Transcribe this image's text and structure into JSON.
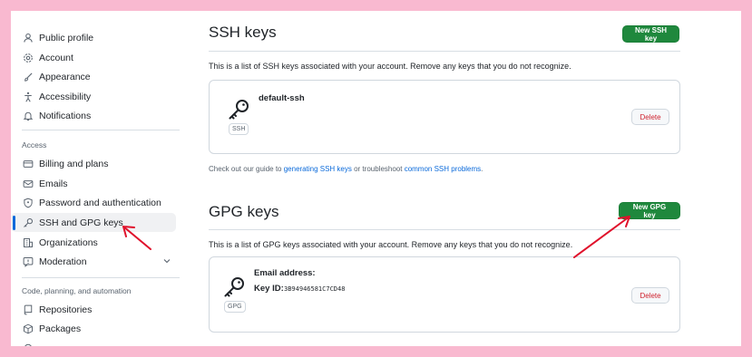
{
  "sidebar": {
    "items_top": [
      {
        "label": "Public profile",
        "icon": "person-icon"
      },
      {
        "label": "Account",
        "icon": "gear-icon"
      },
      {
        "label": "Appearance",
        "icon": "paintbrush-icon"
      },
      {
        "label": "Accessibility",
        "icon": "accessibility-icon"
      },
      {
        "label": "Notifications",
        "icon": "bell-icon"
      }
    ],
    "access_heading": "Access",
    "items_access": [
      {
        "label": "Billing and plans",
        "icon": "credit-card-icon"
      },
      {
        "label": "Emails",
        "icon": "mail-icon"
      },
      {
        "label": "Password and authentication",
        "icon": "shield-icon"
      },
      {
        "label": "SSH and GPG keys",
        "icon": "key-icon"
      },
      {
        "label": "Organizations",
        "icon": "organization-icon"
      },
      {
        "label": "Moderation",
        "icon": "report-icon"
      }
    ],
    "code_heading": "Code, planning, and automation",
    "items_code": [
      {
        "label": "Repositories",
        "icon": "repo-icon"
      },
      {
        "label": "Packages",
        "icon": "package-icon"
      }
    ]
  },
  "ssh": {
    "title": "SSH keys",
    "new_button": "New SSH key",
    "description": "This is a list of SSH keys associated with your account. Remove any keys that you do not recognize.",
    "key_name": "default-ssh",
    "key_tag": "SSH",
    "delete_label": "Delete",
    "note_prefix": "Check out our guide to ",
    "note_link1": "generating SSH keys",
    "note_middle": " or troubleshoot ",
    "note_link2": "common SSH problems",
    "note_suffix": "."
  },
  "gpg": {
    "title": "GPG keys",
    "new_button": "New GPG key",
    "description": "This is a list of GPG keys associated with your account. Remove any keys that you do not recognize.",
    "email_label": "Email address:",
    "keyid_label": "Key ID:",
    "keyid_value": "3B94946581C7CD48",
    "key_tag": "GPG",
    "delete_label": "Delete"
  },
  "colors": {
    "accent": "#0969da",
    "primary_button": "#1f883d",
    "danger": "#cf222e",
    "annotation": "#e0112b",
    "frame_background": "#f9b9d0"
  }
}
